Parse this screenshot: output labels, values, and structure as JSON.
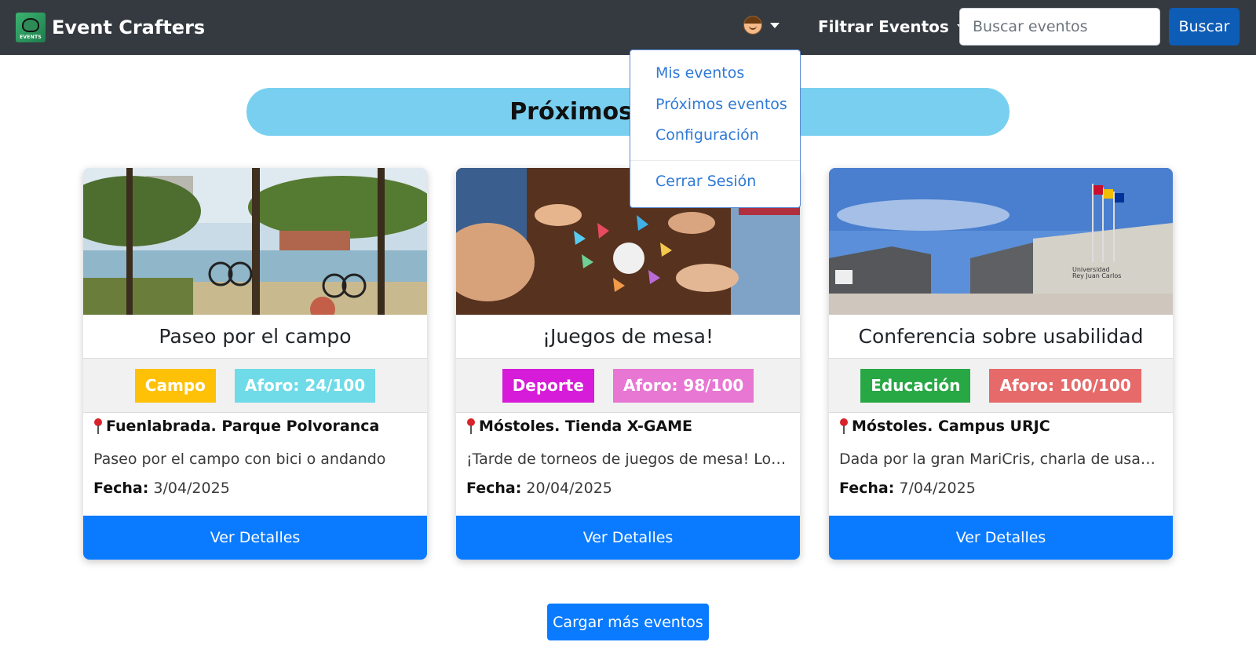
{
  "navbar": {
    "brand_name": "Event Crafters",
    "logo_text": "EVENTS",
    "filter_label": "Filtrar Eventos",
    "search_placeholder": "Buscar eventos",
    "search_button": "Buscar"
  },
  "user_menu": {
    "items": [
      "Mis eventos",
      "Próximos eventos",
      "Configuración"
    ],
    "logout": "Cerrar Sesión"
  },
  "heading": "Próximos eventos",
  "cards": [
    {
      "title": "Paseo por el campo",
      "category": "Campo",
      "category_color": "#ffc107",
      "capacity": "Aforo: 24/100",
      "capacity_color": "#6fdbe8",
      "location": "Fuenlabrada. Parque Polvoranca",
      "description": "Paseo por el campo con bici o andando",
      "date_label": "Fecha:",
      "date": "3/04/2025",
      "button": "Ver Detalles",
      "image": "park-photo"
    },
    {
      "title": "¡Juegos de mesa!",
      "category": "Deporte",
      "category_color": "#d61bd9",
      "capacity": "Aforo: 98/100",
      "capacity_color": "#e777d3",
      "location": "Móstoles. Tienda X-GAME",
      "description": "¡Tarde de torneos de juegos de mesa! Los ga...",
      "date_label": "Fecha:",
      "date": "20/04/2025",
      "button": "Ver Detalles",
      "image": "board-game-photo"
    },
    {
      "title": "Conferencia sobre usabilidad",
      "category": "Educación",
      "category_color": "#28a745",
      "capacity": "Aforo: 100/100",
      "capacity_color": "#e66a6a",
      "location": "Móstoles. Campus URJC",
      "description": "Dada por la gran MariCris, charla de usabilid...",
      "date_label": "Fecha:",
      "date": "7/04/2025",
      "button": "Ver Detalles",
      "image": "university-campus-photo"
    }
  ],
  "load_more": "Cargar más eventos"
}
